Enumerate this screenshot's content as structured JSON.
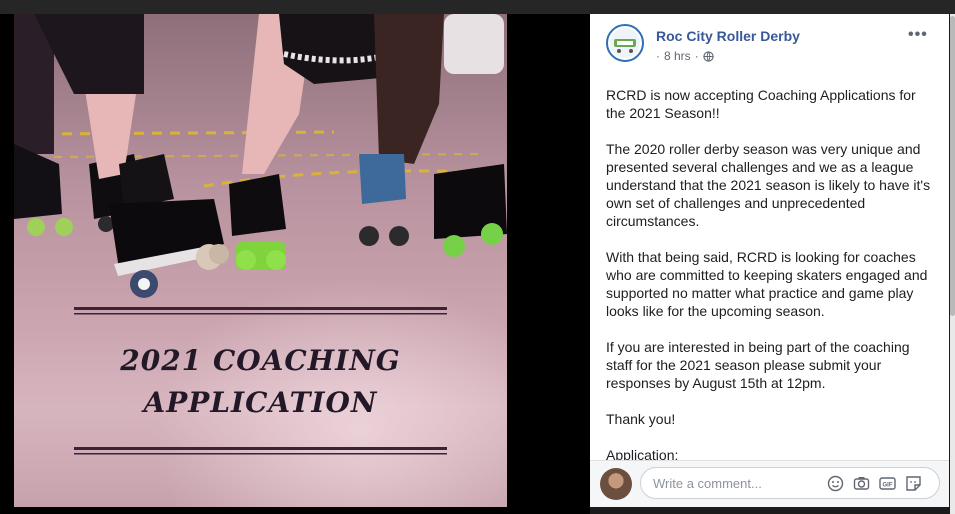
{
  "photo": {
    "poster_line1": "2021 COACHING",
    "poster_line2": "APPLICATION"
  },
  "post": {
    "page_name": "Roc City Roller Derby",
    "time": "8 hrs",
    "privacy_icon": "globe-icon",
    "more_label": "•••",
    "paragraphs": [
      "RCRD is now accepting Coaching Applications for the 2021 Season!!",
      "The 2020 roller derby season was very unique and presented several challenges and we as a league understand that the 2021 season is likely to have it's own set of challenges and unprecedented circumstances.",
      "With that being said, RCRD is looking for coaches who are committed to keeping skaters engaged and supported no matter what practice and game play looks like for the upcoming season.",
      "If you are interested in being part of the coaching staff for the 2021 season please submit your responses by August 15th at 12pm.",
      "Thank you!",
      "Application:"
    ]
  },
  "comment": {
    "placeholder": "Write a comment...",
    "icons": [
      "emoji-icon",
      "camera-icon",
      "gif-icon",
      "sticker-icon"
    ]
  },
  "colors": {
    "page_name": "#385898",
    "avatar_ring": "#2f6fb7"
  }
}
